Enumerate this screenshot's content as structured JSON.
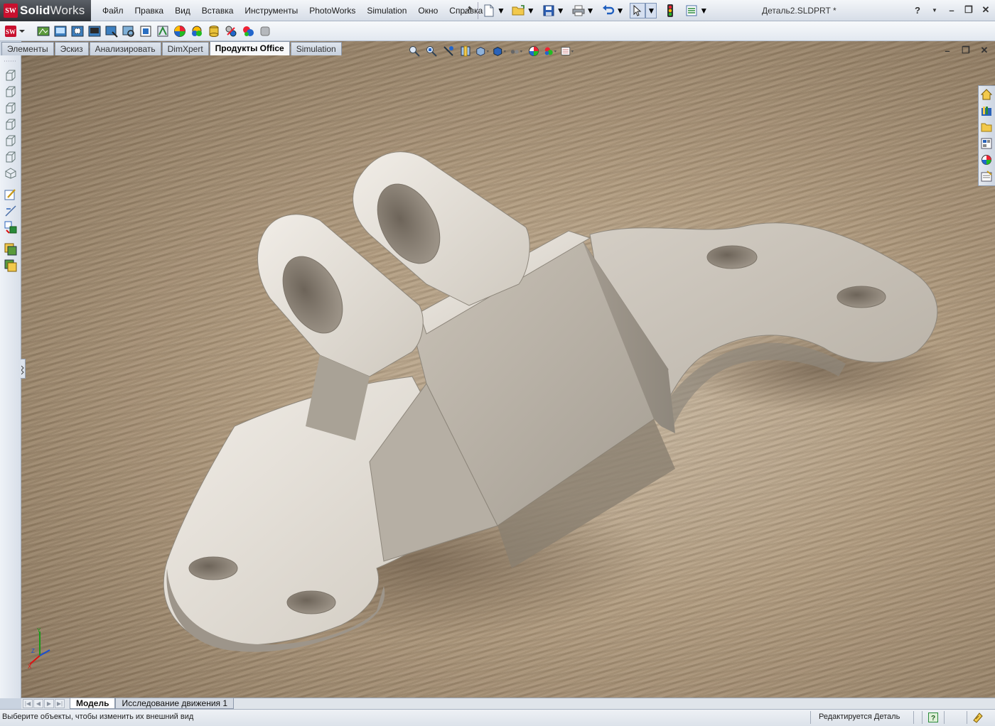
{
  "app": {
    "brand_prefix": "Solid",
    "brand_suffix": "Works",
    "logo_mark": "SW"
  },
  "menu": [
    "Файл",
    "Правка",
    "Вид",
    "Вставка",
    "Инструменты",
    "PhotoWorks",
    "Simulation",
    "Окно",
    "Справка"
  ],
  "document_title": "Деталь2.SLDPRT *",
  "window_controls": {
    "help": "?",
    "minimize": "–",
    "restore": "❐",
    "close": "✕"
  },
  "cmd_tabs": [
    {
      "label": "Элементы",
      "active": false
    },
    {
      "label": "Эскиз",
      "active": false
    },
    {
      "label": "Анализировать",
      "active": false
    },
    {
      "label": "DimXpert",
      "active": false
    },
    {
      "label": "Продукты Office",
      "active": true
    },
    {
      "label": "Simulation",
      "active": false
    }
  ],
  "bottom_tabs": [
    {
      "label": "Модель",
      "active": true
    },
    {
      "label": "Исследование движения 1",
      "active": false
    }
  ],
  "status": {
    "message": "Выберите объекты, чтобы изменить их внешний вид",
    "mode": "Редактируется Деталь"
  },
  "triad": {
    "x": "X",
    "y": "Y",
    "z": "Z"
  },
  "icons": {
    "standard_toolbar": [
      "new-document-icon",
      "open-folder-icon",
      "save-icon",
      "print-icon",
      "undo-icon",
      "select-arrow-icon",
      "rebuild-traffic-light-icon",
      "options-icon"
    ],
    "command_manager": [
      "photoworks-icon",
      "render-icon",
      "render-region-icon",
      "render-last-icon",
      "render-to-file-icon",
      "scene-icon",
      "decal-icon",
      "lights-icon",
      "appearance-icon",
      "appearance-zoom-icon",
      "animator-icon",
      "stack-icon",
      "toolbox-icon",
      "color-swap-icon",
      "material-icon"
    ],
    "heads_up": [
      "zoom-to-fit-icon",
      "zoom-area-icon",
      "previous-view-icon",
      "section-view-icon",
      "view-orientation-icon",
      "display-style-icon",
      "hide-show-icon",
      "edit-appearance-icon",
      "apply-scene-icon",
      "view-settings-icon"
    ],
    "left_toolbar": [
      "front-view-icon",
      "back-view-icon",
      "left-view-icon",
      "right-view-icon",
      "top-view-icon",
      "bottom-view-icon",
      "isometric-view-icon",
      "sketch-icon",
      "smart-dimension-icon",
      "relations-icon",
      "copy-appearance-icon",
      "paste-appearance-icon"
    ],
    "task_pane": [
      "home-icon",
      "design-library-icon",
      "file-explorer-icon",
      "view-palette-icon",
      "appearances-icon",
      "custom-properties-icon"
    ]
  },
  "colors": {
    "accent_blue": "#1f4f9e",
    "logo_red": "#c8102e",
    "part_metal": "#d8d2c9",
    "background_tan": "#b09a7d"
  }
}
